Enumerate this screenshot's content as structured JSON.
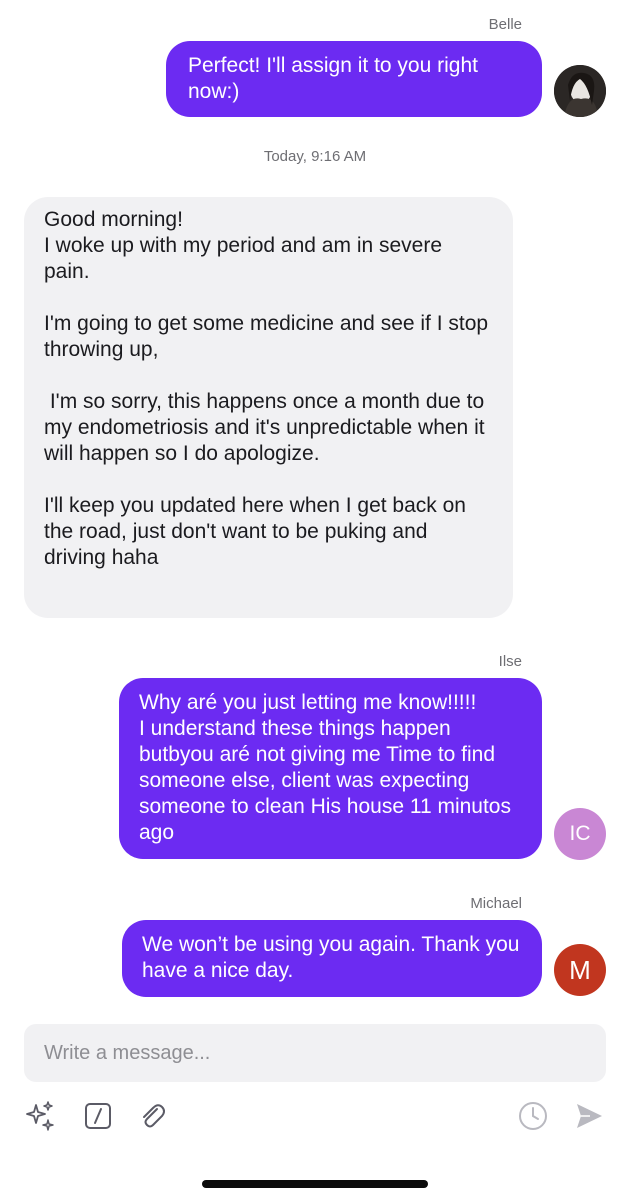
{
  "messages": [
    {
      "sender": "Belle",
      "text": "Perfect! I'll assign it to you right now:)",
      "avatar_initials": ""
    },
    {
      "text": "Good morning!\nI woke up with my period and am in severe pain.\n\nI'm going to get some medicine and see if I stop throwing up,\n\n I'm so sorry, this happens once a month due to my endometriosis and it's unpredictable when it will happen so I do apologize.\n\nI'll keep you updated here when I get back on the road, just don't want to be puking and driving haha"
    },
    {
      "sender": "Ilse",
      "text": "Why aré you just letting me know!!!!!\nI understand these things happen butbyou aré not giving me Time to find someone else, client was expecting someone to clean His house 11 minutos ago",
      "avatar_initials": "IC"
    },
    {
      "sender": "Michael",
      "text": "We won’t be using you again. Thank you have a nice day.",
      "avatar_initials": "M"
    }
  ],
  "timestamp": "Today, 9:16 AM",
  "composer": {
    "placeholder": "Write a message..."
  },
  "colors": {
    "outgoing_bubble": "#6c2bf2",
    "incoming_bubble": "#f1f1f3",
    "avatar_ic": "#c987d4",
    "avatar_m": "#c1361f"
  }
}
